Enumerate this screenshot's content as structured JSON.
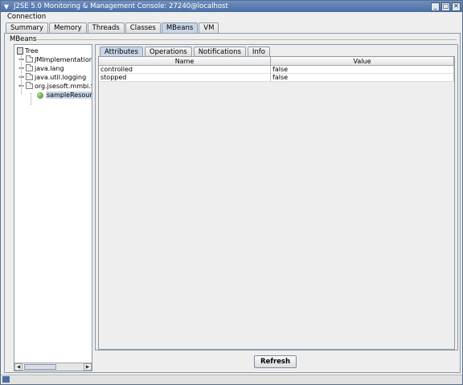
{
  "window": {
    "title": "J2SE 5.0 Monitoring & Management Console: 27240@localhost"
  },
  "menubar": {
    "items": [
      "Connection"
    ]
  },
  "main_tabs": [
    "Summary",
    "Memory",
    "Threads",
    "Classes",
    "MBeans",
    "VM"
  ],
  "active_main_tab": "MBeans",
  "mbeans": {
    "section_label": "MBeans",
    "tree": {
      "root": "Tree",
      "nodes": [
        {
          "label": "JMImplementation"
        },
        {
          "label": "java.lang"
        },
        {
          "label": "java.util.logging"
        },
        {
          "label": "org.jsesoft.mmbi.S"
        },
        {
          "label": "sampleResour"
        }
      ]
    },
    "subtabs": [
      "Attributes",
      "Operations",
      "Notifications",
      "Info"
    ],
    "active_subtab": "Attributes",
    "table": {
      "columns": [
        "Name",
        "Value"
      ],
      "rows": [
        [
          "controlled",
          "false"
        ],
        [
          "stopped",
          "false"
        ]
      ]
    },
    "refresh_label": "Refresh"
  },
  "colors": {
    "titlebar": "#4a6fa6",
    "selection": "#c8d6e8",
    "background": "#eeeeee"
  }
}
